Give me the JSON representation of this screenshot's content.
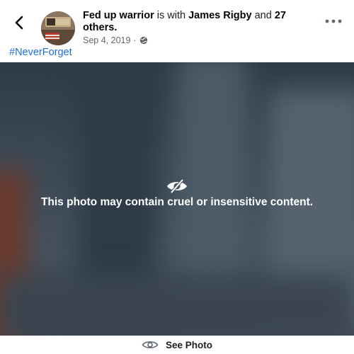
{
  "post": {
    "author": "Fed up warrior",
    "with_text": "is with",
    "tagged": "James Rigby",
    "and_text": "and",
    "others": "27 others.",
    "date": "Sep 4, 2019",
    "dot": "·",
    "privacy_icon": "globe-icon",
    "hashtag": "#NeverForget"
  },
  "photo": {
    "warning_icon": "eye-slash-icon",
    "warning_text": "This photo may contain cruel or insensitive content."
  },
  "actions": {
    "see_photo_label": "See Photo",
    "see_photo_icon": "eye-icon"
  },
  "colors": {
    "hashtag": "#216fdb",
    "overlay": "#3b4957",
    "meta": "#65676b"
  }
}
